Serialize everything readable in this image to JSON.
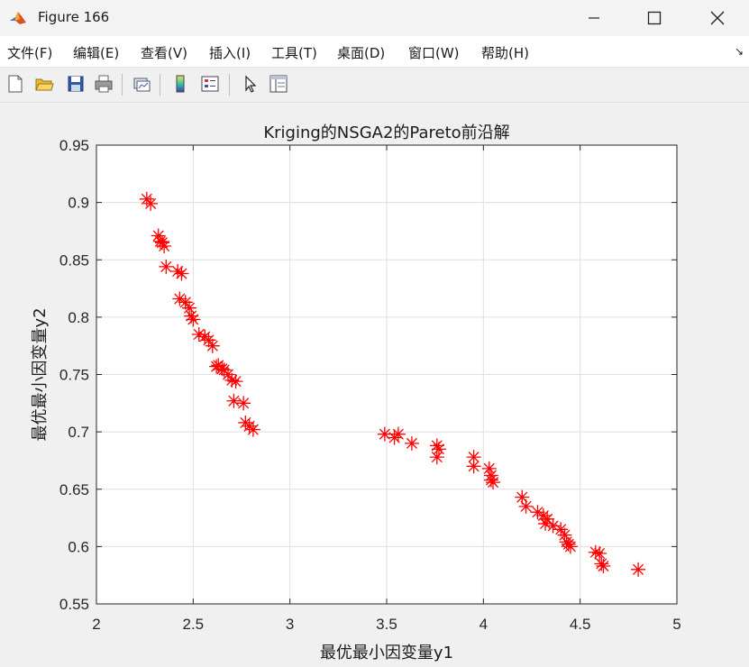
{
  "window": {
    "title": "Figure 166",
    "icon": "matlab-icon"
  },
  "menu": [
    "文件(F)",
    "编辑(E)",
    "查看(V)",
    "插入(I)",
    "工具(T)",
    "桌面(D)",
    "窗口(W)",
    "帮助(H)"
  ],
  "toolbar_icons": [
    "new-figure-icon",
    "open-file-icon",
    "save-icon",
    "print-icon",
    "link-plot-icon",
    "colorbar-icon",
    "legend-icon",
    "pointer-icon",
    "property-inspector-icon"
  ],
  "chart_data": {
    "type": "scatter",
    "title": "Kriging的NSGA2的Pareto前沿解",
    "xlabel": "最优最小因变量y1",
    "ylabel": "最优最小因变量y2",
    "xlim": [
      2,
      5
    ],
    "ylim": [
      0.55,
      0.95
    ],
    "xticks": [
      "2",
      "2.5",
      "3",
      "3.5",
      "4",
      "4.5",
      "5"
    ],
    "yticks": [
      "0.55",
      "0.6",
      "0.65",
      "0.7",
      "0.75",
      "0.8",
      "0.85",
      "0.9",
      "0.95"
    ],
    "grid": true,
    "marker": "*",
    "color": "#ff0000",
    "series": [
      {
        "x": [
          2.26,
          2.28,
          2.32,
          2.33,
          2.35,
          2.34,
          2.36,
          2.42,
          2.44,
          2.43,
          2.46,
          2.48,
          2.49,
          2.5,
          2.53,
          2.56,
          2.58,
          2.6,
          2.62,
          2.63,
          2.65,
          2.66,
          2.68,
          2.7,
          2.71,
          2.72,
          2.76,
          2.77,
          2.79,
          2.81,
          3.49,
          3.54,
          3.56,
          3.63,
          3.76,
          3.77,
          3.76,
          3.95,
          3.95,
          4.03,
          4.04,
          4.04,
          4.05,
          4.2,
          4.22,
          4.28,
          4.31,
          4.33,
          4.32,
          4.36,
          4.4,
          4.42,
          4.43,
          4.44,
          4.45,
          4.58,
          4.6,
          4.61,
          4.62,
          4.8
        ],
        "y": [
          0.903,
          0.899,
          0.871,
          0.866,
          0.862,
          0.865,
          0.844,
          0.84,
          0.838,
          0.816,
          0.813,
          0.808,
          0.801,
          0.798,
          0.785,
          0.783,
          0.78,
          0.775,
          0.757,
          0.758,
          0.755,
          0.754,
          0.75,
          0.745,
          0.727,
          0.744,
          0.725,
          0.708,
          0.705,
          0.702,
          0.698,
          0.695,
          0.698,
          0.69,
          0.688,
          0.685,
          0.678,
          0.678,
          0.67,
          0.668,
          0.662,
          0.658,
          0.656,
          0.643,
          0.635,
          0.63,
          0.627,
          0.624,
          0.62,
          0.618,
          0.615,
          0.61,
          0.604,
          0.602,
          0.6,
          0.595,
          0.594,
          0.585,
          0.583,
          0.58
        ]
      }
    ]
  }
}
